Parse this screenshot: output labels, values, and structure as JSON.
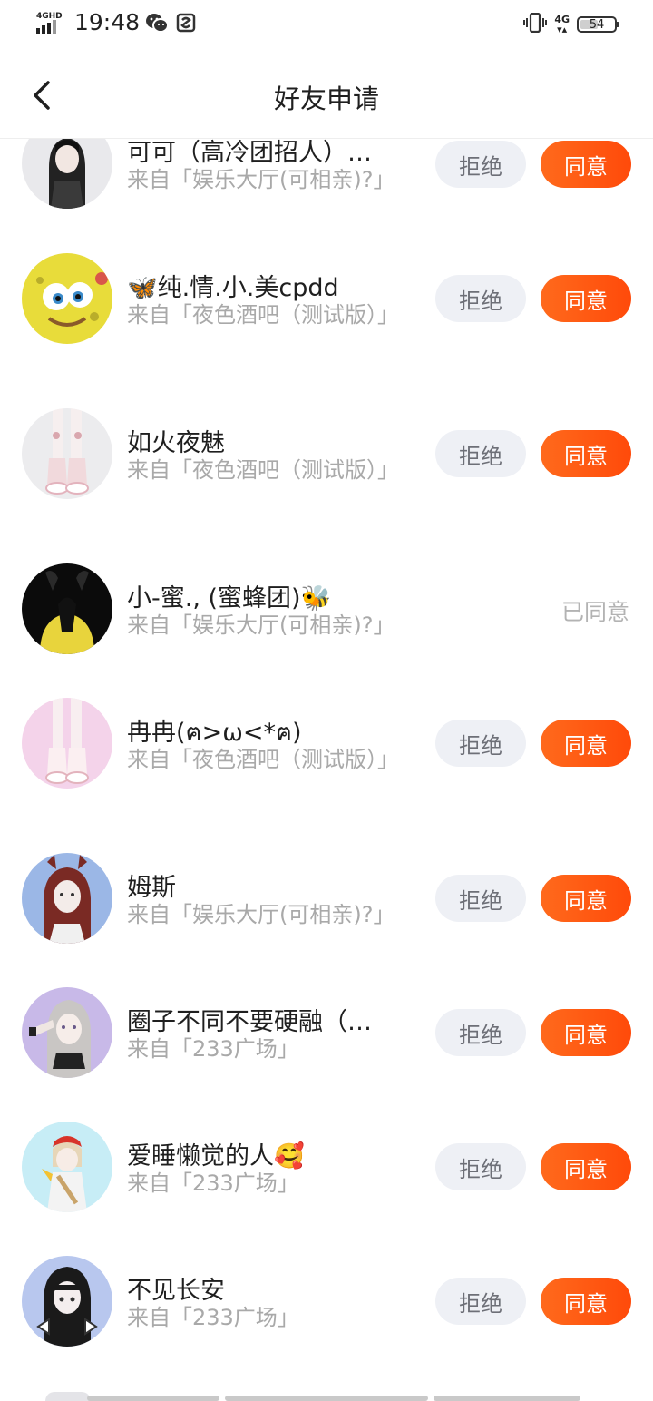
{
  "status_bar": {
    "network_label": "4GHD",
    "time": "19:48",
    "net_right": "4G",
    "battery": "54",
    "battery_level_percent": 54
  },
  "header": {
    "title": "好友申请"
  },
  "items": [
    {
      "name": "可可（高冷团招人）…",
      "source": "来自「娱乐大厅(可相亲)?」",
      "reject_label": "拒绝",
      "agree_label": "同意"
    },
    {
      "name": "🦋纯.情.小.美cpdd",
      "source": "来自「夜色酒吧（测试版）」",
      "reject_label": "拒绝",
      "agree_label": "同意"
    },
    {
      "name": "如火夜魅",
      "source": "来自「夜色酒吧（测试版）」",
      "reject_label": "拒绝",
      "agree_label": "同意"
    },
    {
      "name": "小-蜜., (蜜蜂团)🐝",
      "source": "来自「娱乐大厅(可相亲)?」",
      "status": "已同意"
    },
    {
      "name": "冉冉(ฅ>ω<*ฅ)",
      "source": "来自「夜色酒吧（测试版）」",
      "reject_label": "拒绝",
      "agree_label": "同意"
    },
    {
      "name": "姆斯",
      "source": "来自「娱乐大厅(可相亲)?」",
      "reject_label": "拒绝",
      "agree_label": "同意"
    },
    {
      "name": "圈子不同不要硬融（…",
      "source": "来自「233广场」",
      "reject_label": "拒绝",
      "agree_label": "同意"
    },
    {
      "name": "爱睡懒觉的人🥰",
      "source": "来自「233广场」",
      "reject_label": "拒绝",
      "agree_label": "同意"
    },
    {
      "name": "不见长安",
      "source": "来自「233广场」",
      "reject_label": "拒绝",
      "agree_label": "同意"
    }
  ]
}
